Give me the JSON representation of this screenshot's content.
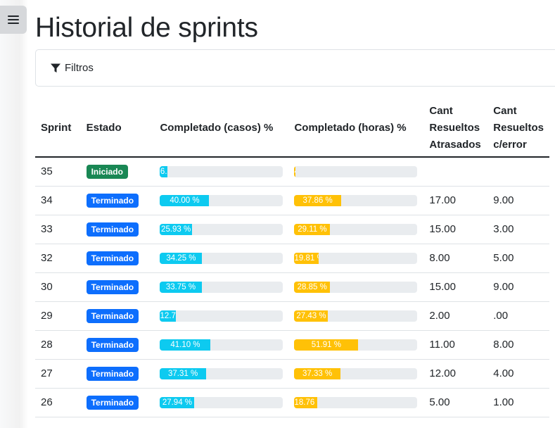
{
  "page": {
    "title": "Historial de sprints"
  },
  "filters": {
    "label": "Filtros",
    "icon": "funnel-icon"
  },
  "colors": {
    "cases_bar": "#0dcaf0",
    "hours_bar": "#ffc107",
    "started": "#198754",
    "finished": "#0d6efd"
  },
  "table": {
    "headers": {
      "sprint": "Sprint",
      "estado": "Estado",
      "casos": "Completado (casos) %",
      "horas": "Completado (horas) %",
      "atrasados": [
        "Cant",
        "Resueltos",
        "Atrasados"
      ],
      "error": [
        "Cant",
        "Resueltos",
        "c/error"
      ]
    },
    "rows": [
      {
        "sprint": "35",
        "estado": "Iniciado",
        "state": "started",
        "casos_label": "6.",
        "casos": 6,
        "horas_label": "4",
        "horas": 1,
        "atrasados": "",
        "error": ""
      },
      {
        "sprint": "34",
        "estado": "Terminado",
        "state": "finished",
        "casos_label": "40.00 %",
        "casos": 40.0,
        "horas_label": "37.86 %",
        "horas": 37.86,
        "atrasados": "17.00",
        "error": "9.00"
      },
      {
        "sprint": "33",
        "estado": "Terminado",
        "state": "finished",
        "casos_label": "25.93 %",
        "casos": 25.93,
        "horas_label": "29.11 %",
        "horas": 29.11,
        "atrasados": "15.00",
        "error": "3.00"
      },
      {
        "sprint": "32",
        "estado": "Terminado",
        "state": "finished",
        "casos_label": "34.25 %",
        "casos": 34.25,
        "horas_label": "19.81 %",
        "horas": 19.81,
        "atrasados": "8.00",
        "error": "5.00"
      },
      {
        "sprint": "30",
        "estado": "Terminado",
        "state": "finished",
        "casos_label": "33.75 %",
        "casos": 33.75,
        "horas_label": "28.85 %",
        "horas": 28.85,
        "atrasados": "15.00",
        "error": "9.00"
      },
      {
        "sprint": "29",
        "estado": "Terminado",
        "state": "finished",
        "casos_label": "12.7",
        "casos": 12.7,
        "horas_label": "27.43 %",
        "horas": 27.43,
        "atrasados": "2.00",
        "error": ".00"
      },
      {
        "sprint": "28",
        "estado": "Terminado",
        "state": "finished",
        "casos_label": "41.10 %",
        "casos": 41.1,
        "horas_label": "51.91 %",
        "horas": 51.91,
        "atrasados": "11.00",
        "error": "8.00"
      },
      {
        "sprint": "27",
        "estado": "Terminado",
        "state": "finished",
        "casos_label": "37.31 %",
        "casos": 37.31,
        "horas_label": "37.33 %",
        "horas": 37.33,
        "atrasados": "12.00",
        "error": "4.00"
      },
      {
        "sprint": "26",
        "estado": "Terminado",
        "state": "finished",
        "casos_label": "27.94 %",
        "casos": 27.94,
        "horas_label": "18.76 %",
        "horas": 18.76,
        "atrasados": "5.00",
        "error": "1.00"
      }
    ]
  }
}
